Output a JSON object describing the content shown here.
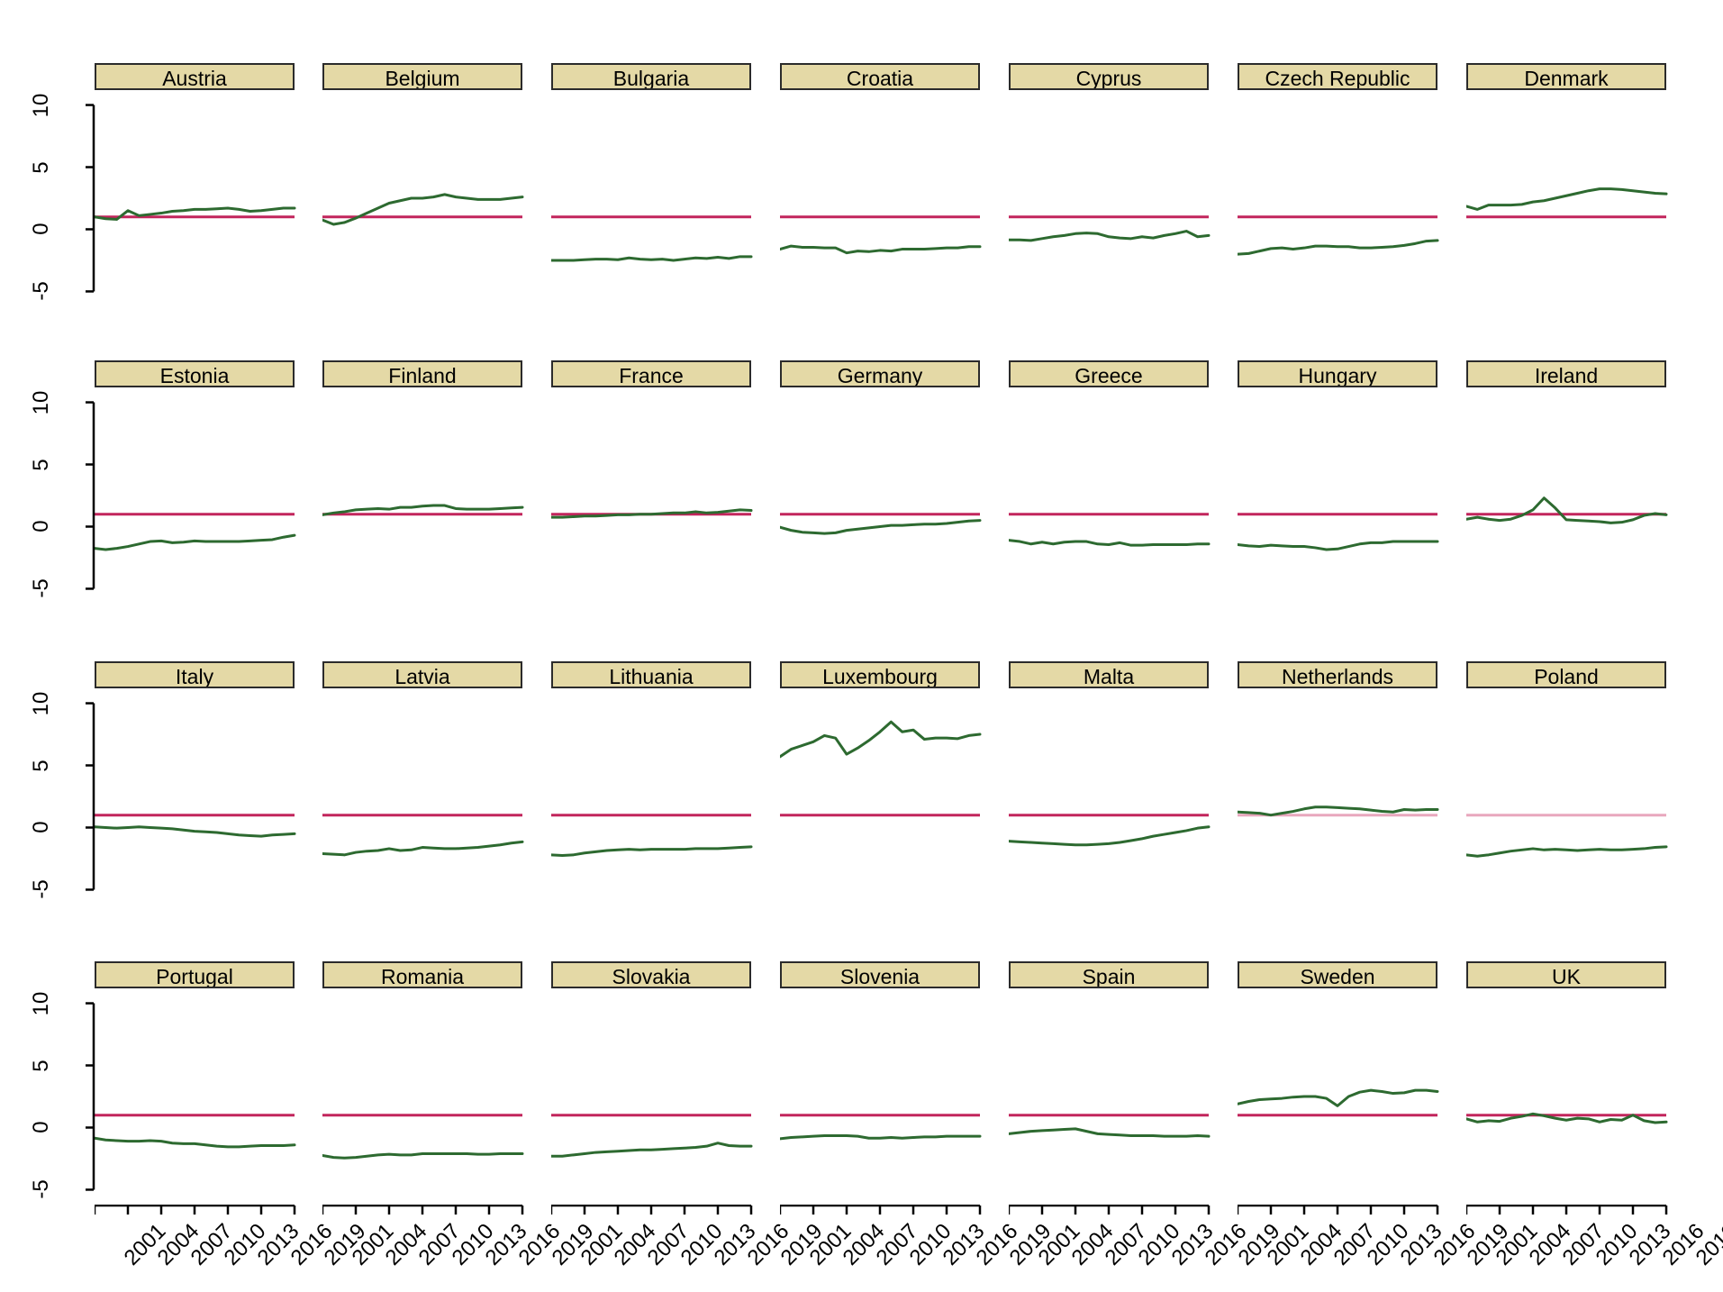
{
  "figure": {
    "type": "small-multiples-line-chart",
    "panel_count": 28,
    "rows": 4,
    "cols": 7,
    "strip_fill": "#e4d9a6",
    "strip_border": "#2b2b2b",
    "line_color": "#2d6a30",
    "reference_line_color": "#c2255c",
    "reference_line_color_light": "#e8a7bd",
    "background": "#ffffff"
  },
  "axes": {
    "y_ticks": [
      "10",
      "5",
      "0",
      "-5"
    ],
    "y_tick_values": [
      10,
      5,
      0,
      -5
    ],
    "ylim": [
      -6.2,
      11.2
    ],
    "x_ticks": [
      "2001",
      "2004",
      "2007",
      "2010",
      "2013",
      "2016",
      "2019"
    ],
    "x_tick_values": [
      2001,
      2004,
      2007,
      2010,
      2013,
      2016,
      2019
    ],
    "xlim": [
      2001,
      2019
    ],
    "grid": false,
    "xlabel": "",
    "ylabel": ""
  },
  "chart_data": {
    "type": "line",
    "title": "",
    "xlabel": "",
    "ylabel": "",
    "x": [
      2001,
      2002,
      2003,
      2004,
      2005,
      2006,
      2007,
      2008,
      2009,
      2010,
      2011,
      2012,
      2013,
      2014,
      2015,
      2016,
      2017,
      2018,
      2019
    ],
    "xlim": [
      2001,
      2019
    ],
    "ylim": [
      -6.2,
      11.2
    ],
    "x_tick_labels": [
      "2001",
      "2004",
      "2007",
      "2010",
      "2013",
      "2016",
      "2019"
    ],
    "y_tick_labels": [
      "10",
      "5",
      "0",
      "-5"
    ],
    "grid": false,
    "legend": "none",
    "reference_line_value": 1.0,
    "series": [
      {
        "name": "Austria",
        "panel": 1,
        "reference_light": false,
        "values": [
          1.0,
          0.85,
          0.8,
          1.5,
          1.1,
          1.2,
          1.3,
          1.45,
          1.5,
          1.6,
          1.6,
          1.65,
          1.7,
          1.6,
          1.45,
          1.5,
          1.6,
          1.7,
          1.7
        ]
      },
      {
        "name": "Belgium",
        "panel": 2,
        "reference_light": false,
        "values": [
          0.75,
          0.4,
          0.55,
          0.9,
          1.3,
          1.7,
          2.1,
          2.3,
          2.5,
          2.5,
          2.6,
          2.8,
          2.6,
          2.5,
          2.4,
          2.4,
          2.4,
          2.5,
          2.6
        ]
      },
      {
        "name": "Bulgaria",
        "panel": 3,
        "reference_light": false,
        "values": [
          -2.5,
          -2.5,
          -2.5,
          -2.45,
          -2.4,
          -2.4,
          -2.45,
          -2.3,
          -2.4,
          -2.45,
          -2.4,
          -2.5,
          -2.4,
          -2.3,
          -2.35,
          -2.25,
          -2.35,
          -2.2,
          -2.2
        ]
      },
      {
        "name": "Croatia",
        "panel": 4,
        "reference_light": false,
        "values": [
          -1.6,
          -1.35,
          -1.45,
          -1.45,
          -1.5,
          -1.5,
          -1.9,
          -1.75,
          -1.8,
          -1.7,
          -1.75,
          -1.6,
          -1.6,
          -1.6,
          -1.55,
          -1.5,
          -1.5,
          -1.4,
          -1.4
        ]
      },
      {
        "name": "Cyprus",
        "panel": 5,
        "reference_light": false,
        "values": [
          -0.85,
          -0.85,
          -0.9,
          -0.75,
          -0.6,
          -0.5,
          -0.35,
          -0.3,
          -0.35,
          -0.6,
          -0.7,
          -0.75,
          -0.6,
          -0.7,
          -0.5,
          -0.35,
          -0.15,
          -0.6,
          -0.5
        ]
      },
      {
        "name": "Czech Republic",
        "panel": 6,
        "reference_light": false,
        "values": [
          -2.0,
          -1.95,
          -1.75,
          -1.55,
          -1.5,
          -1.6,
          -1.5,
          -1.35,
          -1.35,
          -1.4,
          -1.4,
          -1.5,
          -1.5,
          -1.45,
          -1.4,
          -1.3,
          -1.15,
          -0.95,
          -0.9
        ]
      },
      {
        "name": "Denmark",
        "panel": 7,
        "reference_light": false,
        "values": [
          1.85,
          1.6,
          1.95,
          1.95,
          1.95,
          2.0,
          2.2,
          2.3,
          2.5,
          2.7,
          2.9,
          3.1,
          3.25,
          3.25,
          3.2,
          3.1,
          3.0,
          2.9,
          2.85
        ]
      },
      {
        "name": "Estonia",
        "panel": 8,
        "reference_light": false,
        "values": [
          -1.75,
          -1.85,
          -1.75,
          -1.6,
          -1.4,
          -1.2,
          -1.15,
          -1.3,
          -1.25,
          -1.15,
          -1.2,
          -1.2,
          -1.2,
          -1.2,
          -1.15,
          -1.1,
          -1.05,
          -0.85,
          -0.7
        ]
      },
      {
        "name": "Finland",
        "panel": 9,
        "reference_light": false,
        "values": [
          0.95,
          1.1,
          1.2,
          1.35,
          1.4,
          1.45,
          1.4,
          1.55,
          1.55,
          1.65,
          1.7,
          1.7,
          1.45,
          1.4,
          1.4,
          1.4,
          1.45,
          1.5,
          1.55
        ]
      },
      {
        "name": "France",
        "panel": 10,
        "reference_light": false,
        "values": [
          0.75,
          0.75,
          0.8,
          0.85,
          0.85,
          0.9,
          0.95,
          0.95,
          1.0,
          1.0,
          1.05,
          1.1,
          1.1,
          1.2,
          1.1,
          1.15,
          1.25,
          1.35,
          1.3
        ]
      },
      {
        "name": "Germany",
        "panel": 11,
        "reference_light": false,
        "values": [
          -0.05,
          -0.3,
          -0.45,
          -0.5,
          -0.55,
          -0.5,
          -0.3,
          -0.2,
          -0.1,
          0.0,
          0.1,
          0.1,
          0.15,
          0.2,
          0.2,
          0.25,
          0.35,
          0.45,
          0.5
        ]
      },
      {
        "name": "Greece",
        "panel": 12,
        "reference_light": false,
        "values": [
          -1.1,
          -1.2,
          -1.4,
          -1.25,
          -1.4,
          -1.25,
          -1.2,
          -1.2,
          -1.4,
          -1.45,
          -1.3,
          -1.5,
          -1.5,
          -1.45,
          -1.45,
          -1.45,
          -1.45,
          -1.4,
          -1.4
        ]
      },
      {
        "name": "Hungary",
        "panel": 13,
        "reference_light": false,
        "values": [
          -1.45,
          -1.55,
          -1.6,
          -1.5,
          -1.55,
          -1.6,
          -1.6,
          -1.7,
          -1.85,
          -1.8,
          -1.6,
          -1.4,
          -1.3,
          -1.3,
          -1.2,
          -1.2,
          -1.2,
          -1.2,
          -1.2
        ]
      },
      {
        "name": "Ireland",
        "panel": 14,
        "reference_light": false,
        "values": [
          0.6,
          0.75,
          0.6,
          0.5,
          0.6,
          0.9,
          1.35,
          2.3,
          1.5,
          0.55,
          0.5,
          0.45,
          0.4,
          0.3,
          0.35,
          0.55,
          0.9,
          1.05,
          0.95
        ]
      },
      {
        "name": "Italy",
        "panel": 15,
        "reference_light": false,
        "values": [
          0.05,
          0.0,
          -0.05,
          0.0,
          0.05,
          0.0,
          -0.05,
          -0.1,
          -0.2,
          -0.3,
          -0.35,
          -0.4,
          -0.5,
          -0.6,
          -0.65,
          -0.7,
          -0.6,
          -0.55,
          -0.5
        ]
      },
      {
        "name": "Latvia",
        "panel": 16,
        "reference_light": false,
        "values": [
          -2.1,
          -2.15,
          -2.2,
          -2.0,
          -1.9,
          -1.85,
          -1.7,
          -1.85,
          -1.8,
          -1.6,
          -1.65,
          -1.7,
          -1.7,
          -1.65,
          -1.6,
          -1.5,
          -1.4,
          -1.25,
          -1.15
        ]
      },
      {
        "name": "Lithuania",
        "panel": 17,
        "reference_light": false,
        "values": [
          -2.2,
          -2.25,
          -2.2,
          -2.05,
          -1.95,
          -1.85,
          -1.8,
          -1.75,
          -1.8,
          -1.75,
          -1.75,
          -1.75,
          -1.75,
          -1.7,
          -1.7,
          -1.7,
          -1.65,
          -1.6,
          -1.55
        ]
      },
      {
        "name": "Luxembourg",
        "panel": 18,
        "reference_light": false,
        "values": [
          5.7,
          6.3,
          6.6,
          6.9,
          7.4,
          7.2,
          5.9,
          6.4,
          7.0,
          7.7,
          8.5,
          7.7,
          7.85,
          7.1,
          7.2,
          7.2,
          7.15,
          7.4,
          7.5
        ]
      },
      {
        "name": "Malta",
        "panel": 19,
        "reference_light": false,
        "values": [
          -1.1,
          -1.15,
          -1.2,
          -1.25,
          -1.3,
          -1.35,
          -1.4,
          -1.4,
          -1.35,
          -1.3,
          -1.2,
          -1.05,
          -0.9,
          -0.7,
          -0.55,
          -0.4,
          -0.25,
          -0.05,
          0.05
        ]
      },
      {
        "name": "Netherlands",
        "panel": 20,
        "reference_light": true,
        "values": [
          1.25,
          1.2,
          1.15,
          1.0,
          1.15,
          1.3,
          1.5,
          1.65,
          1.65,
          1.6,
          1.55,
          1.5,
          1.4,
          1.3,
          1.25,
          1.45,
          1.4,
          1.45,
          1.45
        ]
      },
      {
        "name": "Poland",
        "panel": 21,
        "reference_light": true,
        "values": [
          -2.2,
          -2.3,
          -2.2,
          -2.05,
          -1.9,
          -1.8,
          -1.7,
          -1.8,
          -1.75,
          -1.8,
          -1.85,
          -1.8,
          -1.75,
          -1.8,
          -1.8,
          -1.75,
          -1.7,
          -1.6,
          -1.55
        ]
      },
      {
        "name": "Portugal",
        "panel": 22,
        "reference_light": false,
        "values": [
          -0.85,
          -1.0,
          -1.05,
          -1.1,
          -1.1,
          -1.05,
          -1.1,
          -1.25,
          -1.3,
          -1.3,
          -1.4,
          -1.5,
          -1.55,
          -1.55,
          -1.5,
          -1.45,
          -1.45,
          -1.45,
          -1.4
        ]
      },
      {
        "name": "Romania",
        "panel": 23,
        "reference_light": false,
        "values": [
          -2.25,
          -2.4,
          -2.45,
          -2.4,
          -2.3,
          -2.2,
          -2.15,
          -2.2,
          -2.2,
          -2.1,
          -2.1,
          -2.1,
          -2.1,
          -2.1,
          -2.15,
          -2.15,
          -2.1,
          -2.1,
          -2.1
        ]
      },
      {
        "name": "Slovakia",
        "panel": 24,
        "reference_light": false,
        "values": [
          -2.3,
          -2.3,
          -2.2,
          -2.1,
          -2.0,
          -1.95,
          -1.9,
          -1.85,
          -1.8,
          -1.8,
          -1.75,
          -1.7,
          -1.65,
          -1.6,
          -1.5,
          -1.25,
          -1.45,
          -1.5,
          -1.5
        ]
      },
      {
        "name": "Slovenia",
        "panel": 25,
        "reference_light": false,
        "values": [
          -0.9,
          -0.8,
          -0.75,
          -0.7,
          -0.65,
          -0.65,
          -0.65,
          -0.7,
          -0.85,
          -0.85,
          -0.8,
          -0.85,
          -0.8,
          -0.75,
          -0.75,
          -0.7,
          -0.7,
          -0.7,
          -0.7
        ]
      },
      {
        "name": "Spain",
        "panel": 26,
        "reference_light": false,
        "values": [
          -0.5,
          -0.4,
          -0.3,
          -0.25,
          -0.2,
          -0.15,
          -0.1,
          -0.3,
          -0.5,
          -0.55,
          -0.6,
          -0.65,
          -0.65,
          -0.65,
          -0.7,
          -0.7,
          -0.7,
          -0.65,
          -0.7
        ]
      },
      {
        "name": "Sweden",
        "panel": 27,
        "reference_light": false,
        "values": [
          1.9,
          2.1,
          2.25,
          2.3,
          2.35,
          2.45,
          2.5,
          2.5,
          2.35,
          1.75,
          2.5,
          2.85,
          3.0,
          2.9,
          2.75,
          2.8,
          3.0,
          3.0,
          2.9
        ]
      },
      {
        "name": "UK",
        "panel": 28,
        "reference_light": false,
        "values": [
          0.7,
          0.45,
          0.55,
          0.5,
          0.75,
          0.9,
          1.1,
          0.95,
          0.75,
          0.6,
          0.75,
          0.7,
          0.45,
          0.65,
          0.6,
          1.0,
          0.55,
          0.4,
          0.45
        ]
      }
    ]
  },
  "panels": [
    {
      "title": "Austria"
    },
    {
      "title": "Belgium"
    },
    {
      "title": "Bulgaria"
    },
    {
      "title": "Croatia"
    },
    {
      "title": "Cyprus"
    },
    {
      "title": "Czech Republic"
    },
    {
      "title": "Denmark"
    },
    {
      "title": "Estonia"
    },
    {
      "title": "Finland"
    },
    {
      "title": "France"
    },
    {
      "title": "Germany"
    },
    {
      "title": "Greece"
    },
    {
      "title": "Hungary"
    },
    {
      "title": "Ireland"
    },
    {
      "title": "Italy"
    },
    {
      "title": "Latvia"
    },
    {
      "title": "Lithuania"
    },
    {
      "title": "Luxembourg"
    },
    {
      "title": "Malta"
    },
    {
      "title": "Netherlands"
    },
    {
      "title": "Poland"
    },
    {
      "title": "Portugal"
    },
    {
      "title": "Romania"
    },
    {
      "title": "Slovakia"
    },
    {
      "title": "Slovenia"
    },
    {
      "title": "Spain"
    },
    {
      "title": "Sweden"
    },
    {
      "title": "UK"
    }
  ]
}
